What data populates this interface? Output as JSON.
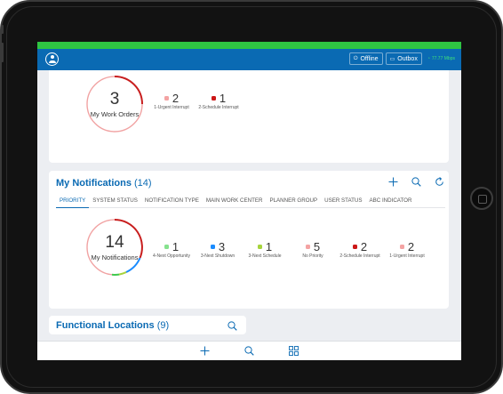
{
  "appbar": {
    "offline_label": "Offline",
    "outbox_label": "Outbox",
    "sync_label": "77.77 Mbps"
  },
  "work_orders": {
    "count": "3",
    "label": "My Work Orders",
    "stats": [
      {
        "value": "2",
        "label": "1-Urgent Interrupt",
        "color": "#f4a3a3"
      },
      {
        "value": "1",
        "label": "2-Schedule Interrupt",
        "color": "#cc1818"
      }
    ]
  },
  "notifications": {
    "title": "My Notifications",
    "count_display": "(14)",
    "tabs": [
      "PRIORITY",
      "SYSTEM STATUS",
      "NOTIFICATION TYPE",
      "MAIN WORK CENTER",
      "PLANNER GROUP",
      "USER STATUS",
      "ABC INDICATOR"
    ],
    "active_tab": "PRIORITY",
    "donut_count": "14",
    "donut_label": "My Notifications",
    "stats": [
      {
        "value": "1",
        "label": "4-Next Opportunity",
        "color": "#86e28e"
      },
      {
        "value": "3",
        "label": "3-Next Shutdown",
        "color": "#1a8cff"
      },
      {
        "value": "1",
        "label": "3-Next Schedule",
        "color": "#a6d43c"
      },
      {
        "value": "5",
        "label": "No Priority",
        "color": "#f4a3a3"
      },
      {
        "value": "2",
        "label": "2-Schedule Interrupt",
        "color": "#cc1818"
      },
      {
        "value": "2",
        "label": "1-Urgent Interrupt",
        "color": "#f4a3a3"
      }
    ]
  },
  "functional_locations": {
    "title": "Functional Locations",
    "count_display": "(9)"
  },
  "icons": {
    "user": "user-icon",
    "offline": "offline-icon",
    "outbox": "outbox-icon",
    "add": "plus-icon",
    "search": "search-icon",
    "refresh": "refresh-icon",
    "grid": "grid-icon"
  },
  "colors": {
    "brand_blue": "#0a6ab3",
    "status_green": "#2fc442",
    "donut_red": "#c81e1e"
  }
}
